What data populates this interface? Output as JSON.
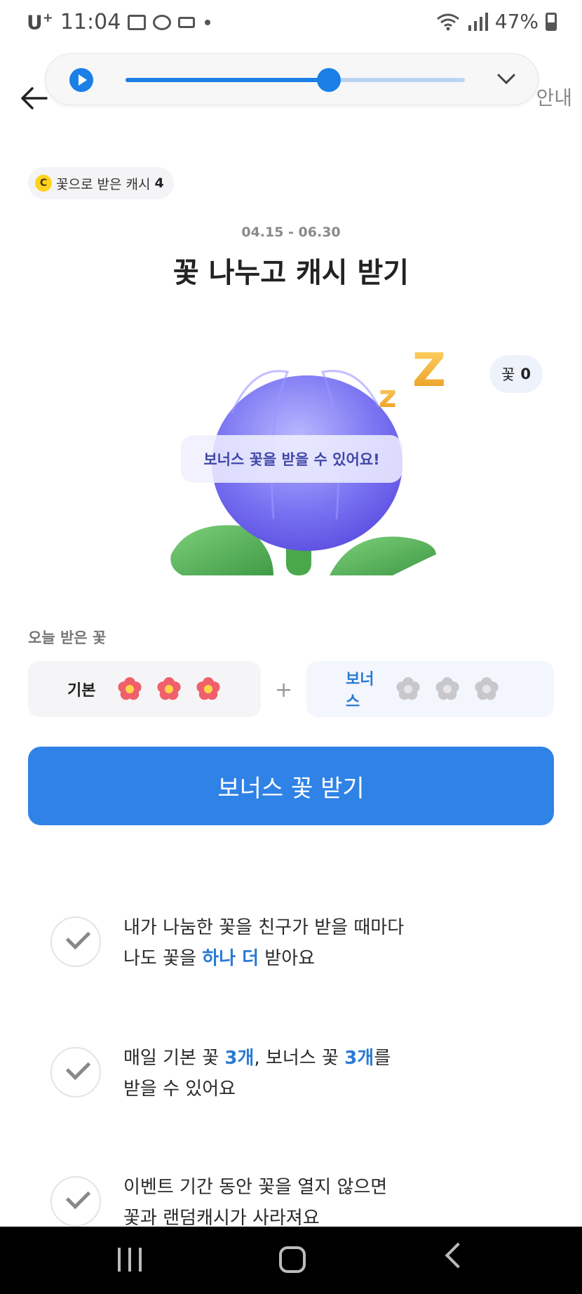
{
  "status_bar": {
    "carrier": "U",
    "carrier_sup": "+",
    "time": "11:04",
    "battery": "47%"
  },
  "header": {
    "guide_label": "안내"
  },
  "player": {
    "progress": 0.6
  },
  "cash_chip": {
    "coin_letter": "C",
    "label": "꽃으로 받은 캐시",
    "amount": "4"
  },
  "event": {
    "period": "04.15 - 06.30",
    "title": "꽃 나누고 캐시 받기"
  },
  "flower": {
    "count_label": "꽃",
    "count_value": "0",
    "bubble": "보너스 꽃을 받을 수 있어요!"
  },
  "today": {
    "section_label": "오늘 받은 꽃",
    "basic_label": "기본",
    "basic_received": 3,
    "plus": "+",
    "bonus_label": "보너스",
    "bonus_received": 0
  },
  "cta": {
    "label": "보너스 꽃 받기"
  },
  "tips": [
    {
      "line1": "내가 나눔한 꽃을 친구가 받을 때마다",
      "line2_a": "나도 꽃을 ",
      "line2_hl": "하나 더",
      "line2_b": " 받아요"
    },
    {
      "line1_a": "매일 기본 꽃 ",
      "line1_hl1": "3개",
      "line1_b": ", 보너스 꽃 ",
      "line1_hl2": "3개",
      "line1_c": "를",
      "line2": "받을 수 있어요"
    },
    {
      "line1": "이벤트 기간 동안 꽃을 열지 않으면",
      "line2": "꽃과 랜덤캐시가 사라져요"
    }
  ],
  "colors": {
    "accent": "#2f82e6",
    "highlight": "#2a7ad4",
    "flower_red": "#f0606a",
    "flower_gray": "#c8c8cc"
  }
}
